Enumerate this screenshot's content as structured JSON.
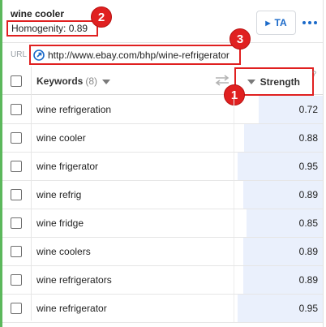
{
  "header": {
    "title": "wine cooler",
    "homogenity": "Homogenity: 0.89",
    "ta_label": "TA"
  },
  "annotations": [
    "1",
    "2",
    "3"
  ],
  "url": {
    "label": "URL",
    "value": "http://www.ebay.com/bhp/wine-refrigerator"
  },
  "table": {
    "keywords_header": "Keywords",
    "keywords_count": "(8)",
    "strength_header": "Strength",
    "help": "?",
    "rows": [
      {
        "keyword": "wine refrigeration",
        "strength": "0.72",
        "strength_value": 0.72
      },
      {
        "keyword": "wine cooler",
        "strength": "0.88",
        "strength_value": 0.88
      },
      {
        "keyword": "wine frigerator",
        "strength": "0.95",
        "strength_value": 0.95
      },
      {
        "keyword": "wine refrig",
        "strength": "0.89",
        "strength_value": 0.89
      },
      {
        "keyword": "wine fridge",
        "strength": "0.85",
        "strength_value": 0.85
      },
      {
        "keyword": "wine coolers",
        "strength": "0.89",
        "strength_value": 0.89
      },
      {
        "keyword": "wine refrigerators",
        "strength": "0.89",
        "strength_value": 0.89
      },
      {
        "keyword": "wine refrigerator",
        "strength": "0.95",
        "strength_value": 0.95
      }
    ]
  },
  "colors": {
    "accent": "#1b6ac9",
    "highlight_red": "#e02020",
    "left_accent": "#5cb85c",
    "bar_fill": "#eaf0fc"
  }
}
